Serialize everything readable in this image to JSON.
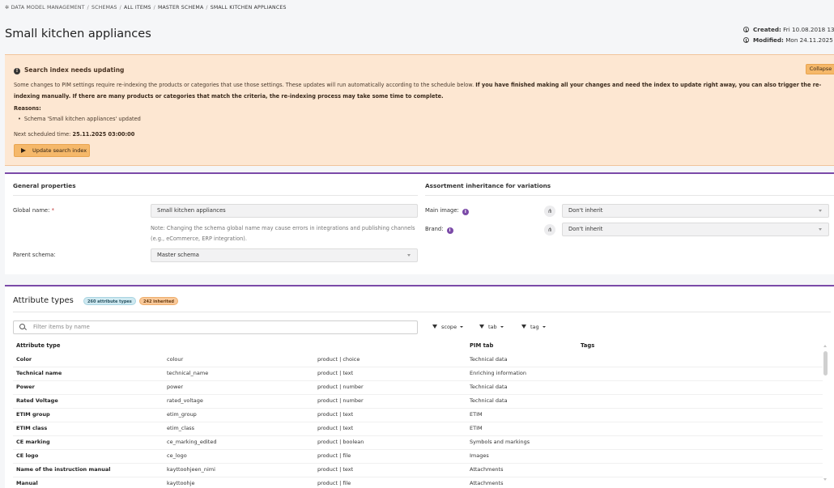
{
  "breadcrumb": {
    "items": [
      "DATA MODEL MANAGEMENT",
      "SCHEMAS",
      "ALL ITEMS",
      "MASTER SCHEMA",
      "SMALL KITCHEN APPLIANCES"
    ],
    "separator": "/"
  },
  "header": {
    "title": "Small kitchen appliances",
    "created_label": "Created:",
    "created_value": "Fri 10.08.2018 13:5",
    "modified_label": "Modified:",
    "modified_value": "Mon 24.11.2025 1"
  },
  "alert": {
    "title": "Search index needs updating",
    "collapse_label": "Collapse",
    "text_normal": "Some changes to PIM settings require re-indexing the products or categories that use those settings. These updates will run automatically according to the schedule below. ",
    "text_bold": "If you have finished making all your changes and need the index to update right away, you can also trigger the re-indexing manually. If there are many products or categories that match the criteria, the re-indexing process may take some time to complete.",
    "reasons_label": "Reasons:",
    "reasons": [
      "Schema 'Small kitchen appliances' updated"
    ],
    "next_label": "Next scheduled time:",
    "next_value": "25.11.2025 03:00:00",
    "update_button": "Update search index"
  },
  "general": {
    "section_title": "General properties",
    "global_name_label": "Global name:",
    "required_mark": "*",
    "global_name_value": "Small kitchen appliances",
    "note": "Note: Changing the schema global name may cause errors in integrations and publishing channels (e.g., eCommerce, ERP integration).",
    "parent_label": "Parent schema:",
    "parent_value": "Master schema"
  },
  "inheritance": {
    "section_title": "Assortment inheritance for variations",
    "main_image_label": "Main image:",
    "main_image_value": "Don't inherit",
    "brand_label": "Brand:",
    "brand_value": "Don't inherit"
  },
  "attributes": {
    "title": "Attribute types",
    "badge_types": "260 attribute types",
    "badge_inherited": "242 inherited",
    "filter_placeholder": "Filter items by name",
    "filters": [
      "scope",
      "tab",
      "tag"
    ],
    "columns": {
      "attribute_type": "Attribute type",
      "pim_tab": "PIM tab",
      "tags": "Tags"
    },
    "rows": [
      {
        "name": "Color",
        "global": "colour",
        "type": "product | choice",
        "tab": "Technical data"
      },
      {
        "name": "Technical name",
        "global": "technical_name",
        "type": "product | text",
        "tab": "Enriching information"
      },
      {
        "name": "Power",
        "global": "power",
        "type": "product | number",
        "tab": "Technical data"
      },
      {
        "name": "Rated Voltage",
        "global": "rated_voltage",
        "type": "product | number",
        "tab": "Technical data"
      },
      {
        "name": "ETIM group",
        "global": "etim_group",
        "type": "product | text",
        "tab": "ETIM"
      },
      {
        "name": "ETIM class",
        "global": "etim_class",
        "type": "product | text",
        "tab": "ETIM"
      },
      {
        "name": "CE marking",
        "global": "ce_marking_edited",
        "type": "product | boolean",
        "tab": "Symbols and markings"
      },
      {
        "name": "CE logo",
        "global": "ce_logo",
        "type": "product | file",
        "tab": "Images"
      },
      {
        "name": "Name of the instruction manual",
        "global": "kayttoohjeen_nimi",
        "type": "product | text",
        "tab": "Attachments"
      },
      {
        "name": "Manual",
        "global": "kayttoohje",
        "type": "product | file",
        "tab": "Attachments"
      }
    ]
  },
  "colors": {
    "accent": "#7b4aa8",
    "alert_bg": "#fde7d2",
    "alert_button": "#f5b86a"
  },
  "icons": [
    "gear-icon",
    "clock-icon",
    "warning-icon",
    "play-icon",
    "info-icon",
    "hierarchy-icon",
    "search-icon",
    "filter-icon",
    "chevron-down-icon"
  ]
}
